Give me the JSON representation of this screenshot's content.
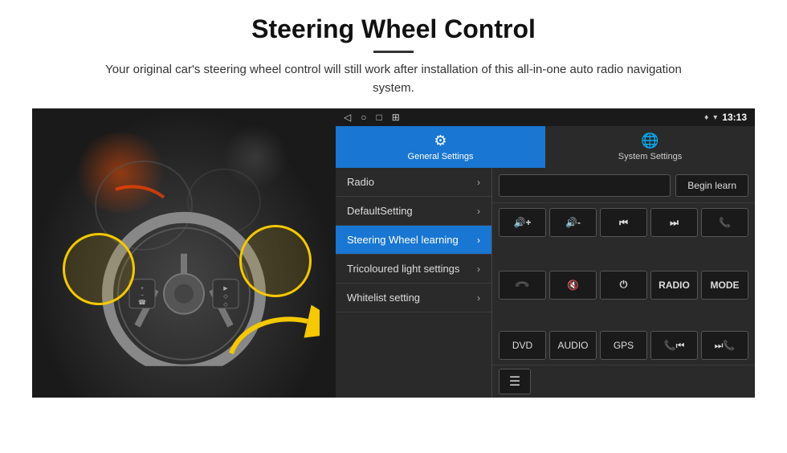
{
  "header": {
    "title": "Steering Wheel Control",
    "divider": true,
    "subtitle": "Your original car's steering wheel control will still work after installation of this all-in-one auto radio navigation system."
  },
  "statusBar": {
    "icons": [
      "◁",
      "○",
      "□",
      "⊞"
    ],
    "rightIcons": "♦ ▾",
    "time": "13:13"
  },
  "tabs": [
    {
      "label": "General Settings",
      "icon": "⚙",
      "active": true
    },
    {
      "label": "System Settings",
      "icon": "🌐",
      "active": false
    }
  ],
  "menuItems": [
    {
      "label": "Radio",
      "active": false
    },
    {
      "label": "DefaultSetting",
      "active": false
    },
    {
      "label": "Steering Wheel learning",
      "active": true
    },
    {
      "label": "Tricoloured light settings",
      "active": false
    },
    {
      "label": "Whitelist setting",
      "active": false
    }
  ],
  "radioRow": {
    "inputPlaceholder": "",
    "beginLearnLabel": "Begin learn"
  },
  "controlButtons": {
    "row1": [
      {
        "label": "🔊+",
        "id": "vol-up"
      },
      {
        "label": "🔊-",
        "id": "vol-down"
      },
      {
        "label": "⏮",
        "id": "prev-track"
      },
      {
        "label": "⏭",
        "id": "next-track"
      },
      {
        "label": "📞",
        "id": "call"
      }
    ],
    "row2": [
      {
        "label": "📞",
        "id": "answer"
      },
      {
        "label": "🔇",
        "id": "mute"
      },
      {
        "label": "⏻",
        "id": "power"
      },
      {
        "label": "RADIO",
        "id": "radio"
      },
      {
        "label": "MODE",
        "id": "mode"
      }
    ],
    "row3": [
      {
        "label": "DVD",
        "id": "dvd"
      },
      {
        "label": "AUDIO",
        "id": "audio"
      },
      {
        "label": "GPS",
        "id": "gps"
      },
      {
        "label": "📞⏮",
        "id": "call-prev"
      },
      {
        "label": "⏭📞",
        "id": "call-next"
      }
    ]
  },
  "lastRow": {
    "iconLabel": "≡"
  }
}
